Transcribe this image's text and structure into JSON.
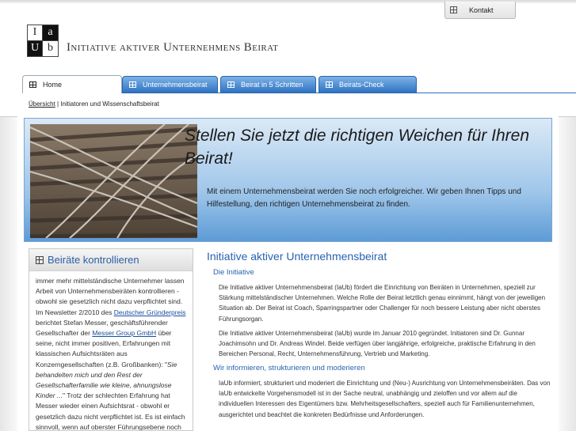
{
  "header": {
    "contact_label": "Kontakt",
    "logo": {
      "tl": "I",
      "tr": "a",
      "bl": "U",
      "br": "b"
    },
    "brand": "Initiative aktiver Unternehmens Beirat"
  },
  "nav": {
    "tabs": [
      {
        "label": "Home"
      },
      {
        "label": "Unternehmensbeirat"
      },
      {
        "label": "Beirat in 5 Schritten"
      },
      {
        "label": "Beirats-Check"
      }
    ]
  },
  "breadcrumb": {
    "link": "Übersicht",
    "separator": " | ",
    "current": "Initiatoren und Wissenschaftsbeirat"
  },
  "hero": {
    "title": "Stellen Sie jetzt die richtigen Weichen für Ihren Beirat!",
    "text": "Mit einem Unternehmensbeirat werden Sie noch erfolgreicher. Wir geben Ihnen Tipps und Hilfestellung, den richtigen Unternehmensbeirat zu finden."
  },
  "sidebar": {
    "title": "Beiräte kontrollieren",
    "p1": "immer mehr mittelständische Unternehmer lassen Arbeit von Unternehmensbeiräten kontrollieren - obwohl sie gesetzlich nicht dazu verpflichtet sind. Im Newsletter 2/2010 des ",
    "link1": "Deutscher Gründerpreis",
    "p2": " berichtet Stefan Messer, geschäftsführender Gesellschafter der ",
    "link2": "Messer Group GmbH",
    "p3": " über seine, nicht immer positiven, Erfahrungen mit klassischen Aufsichtsräten aus Konzerngesellschaften (z.B. Großbanken): \"",
    "quote": "Sie behandelten mich und den Rest der Gesellschafterfamilie wie kleine, ahnungslose Kinder ...",
    "p4": "\" Trotz der schlechten Erfahrung hat Messer wieder einen Aufsichtsrat - obwohl er gesetzlich dazu nicht verpflichtet ist. Es ist einfach sinnvoll, wenn auf oberster Führungsebene noch Korrektive vorhanden"
  },
  "main": {
    "title": "Initiative aktiver Unternehmensbeirat",
    "sections": [
      {
        "heading": "Die Initiative",
        "paragraphs": [
          "Die Initiative aktiver Unternehmensbeirat (IaUb) fördert die Einrichtung von Beiräten in Unternehmen, speziell zur Stärkung mittelständischer Unternehmen. Welche Rolle der Beirat letztlich genau einnimmt, hängt von der jeweiligen Situation ab. Der Beirat ist Coach, Sparringspartner oder Challenger für noch bessere Leistung aber nicht oberstes Führungsorgan.",
          "Die Initiative aktiver Unternehmensbeirat (IaUb) wurde im Januar 2010 gegründet. Initiatoren sind Dr. Gunnar Joachimsohn und Dr. Andreas Windel. Beide verfügen über langjährige, erfolgreiche, praktische Erfahrung in den Bereichen Personal, Recht, Unternehmensführung, Vertrieb und Marketing."
        ]
      },
      {
        "heading": "Wir informieren, strukturieren und moderieren",
        "paragraphs": [
          "IaUb informiert, strukturiert und moderiert die Einrichtung und (Neu-) Ausrichtung von Unternehmensbeiräten. Das von IaUb entwickelte Vorgehensmodell ist in der Sache neutral, unabhängig und zieloffen und vor allem auf die individuellen Interessen des Eigentümers bzw. Mehrheitsgesellschafters, speziell auch für Familienunternehmen, ausgerichtet und beachtet die konkreten Bedürfnisse und Anforderungen."
        ]
      }
    ]
  },
  "colors": {
    "accent_blue": "#2a62b0",
    "tab_blue": "#2f72c2",
    "hero_light": "#dbe9f6",
    "hero_dark": "#5d9bd6"
  },
  "icons": {
    "tab_icon": "window-grid-icon",
    "hero_image": "railway-switch-photo"
  }
}
